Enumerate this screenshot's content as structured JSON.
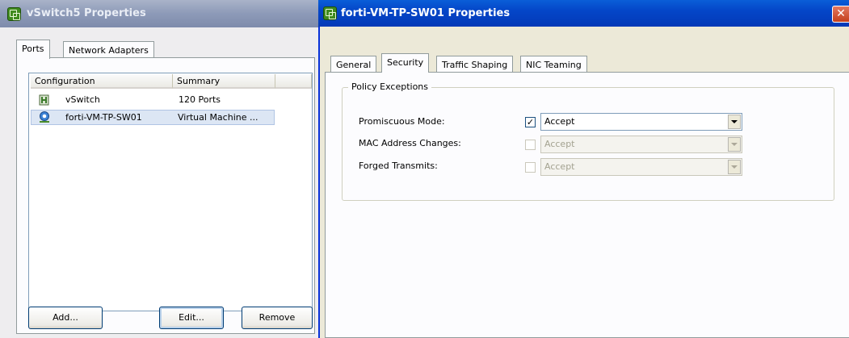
{
  "left_window": {
    "title": "vSwitch5 Properties",
    "tabs": [
      "Ports",
      "Network Adapters"
    ],
    "columns": [
      "Configuration",
      "Summary"
    ],
    "rows": [
      {
        "icon": "vswitch-icon",
        "configuration": "vSwitch",
        "summary": "120 Ports"
      },
      {
        "icon": "virtual-machine-portgroup-icon",
        "configuration": "forti-VM-TP-SW01",
        "summary": "Virtual Machine ..."
      }
    ],
    "buttons": {
      "add": "Add...",
      "edit": "Edit...",
      "remove": "Remove"
    }
  },
  "right_window": {
    "title": "forti-VM-TP-SW01 Properties",
    "close_icon": "close-icon",
    "tabs": [
      "General",
      "Security",
      "Traffic Shaping",
      "NIC Teaming"
    ],
    "active_tab": "Security",
    "group_title": "Policy Exceptions",
    "policies": [
      {
        "label": "Promiscuous Mode:",
        "checked": true,
        "enabled": true,
        "value": "Accept"
      },
      {
        "label": "MAC Address Changes:",
        "checked": false,
        "enabled": false,
        "value": "Accept"
      },
      {
        "label": "Forged Transmits:",
        "checked": false,
        "enabled": false,
        "value": "Accept"
      }
    ]
  },
  "colors": {
    "active_title": "#0446c8",
    "inactive_title": "#8d9ab8",
    "selection": "#dce6f4"
  }
}
